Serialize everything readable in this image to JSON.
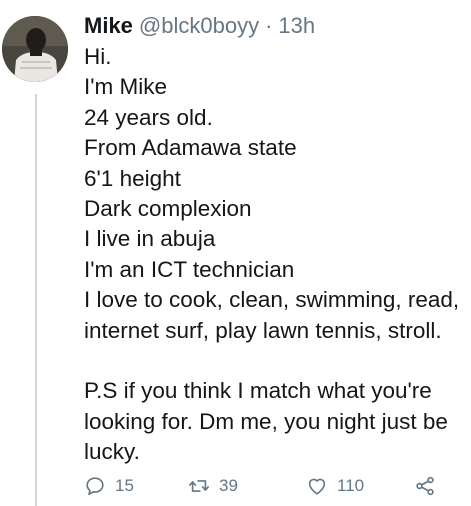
{
  "tweet": {
    "author_name": "Mike",
    "author_handle": "@blck0boyy",
    "separator": "·",
    "time": "13h",
    "lines": [
      "Hi.",
      "I'm Mike",
      "24 years old.",
      "From Adamawa state",
      "6'1 height",
      "Dark complexion",
      "I live in abuja",
      "I'm an ICT technician",
      "I love to cook, clean, swimming, read,",
      "internet surf, play lawn tennis, stroll."
    ],
    "ps_lines": [
      "P.S if you think I match what you're",
      "looking for. Dm me, you night just be",
      "lucky."
    ]
  },
  "actions": {
    "reply": {
      "icon": "reply-icon",
      "count": "15"
    },
    "retweet": {
      "icon": "retweet-icon",
      "count": "39"
    },
    "like": {
      "icon": "like-icon",
      "count": "110"
    },
    "share": {
      "icon": "share-icon"
    }
  },
  "colors": {
    "text": "#14171a",
    "secondary": "#657786",
    "thread_line": "#ccd6dd",
    "background": "#ffffff"
  }
}
